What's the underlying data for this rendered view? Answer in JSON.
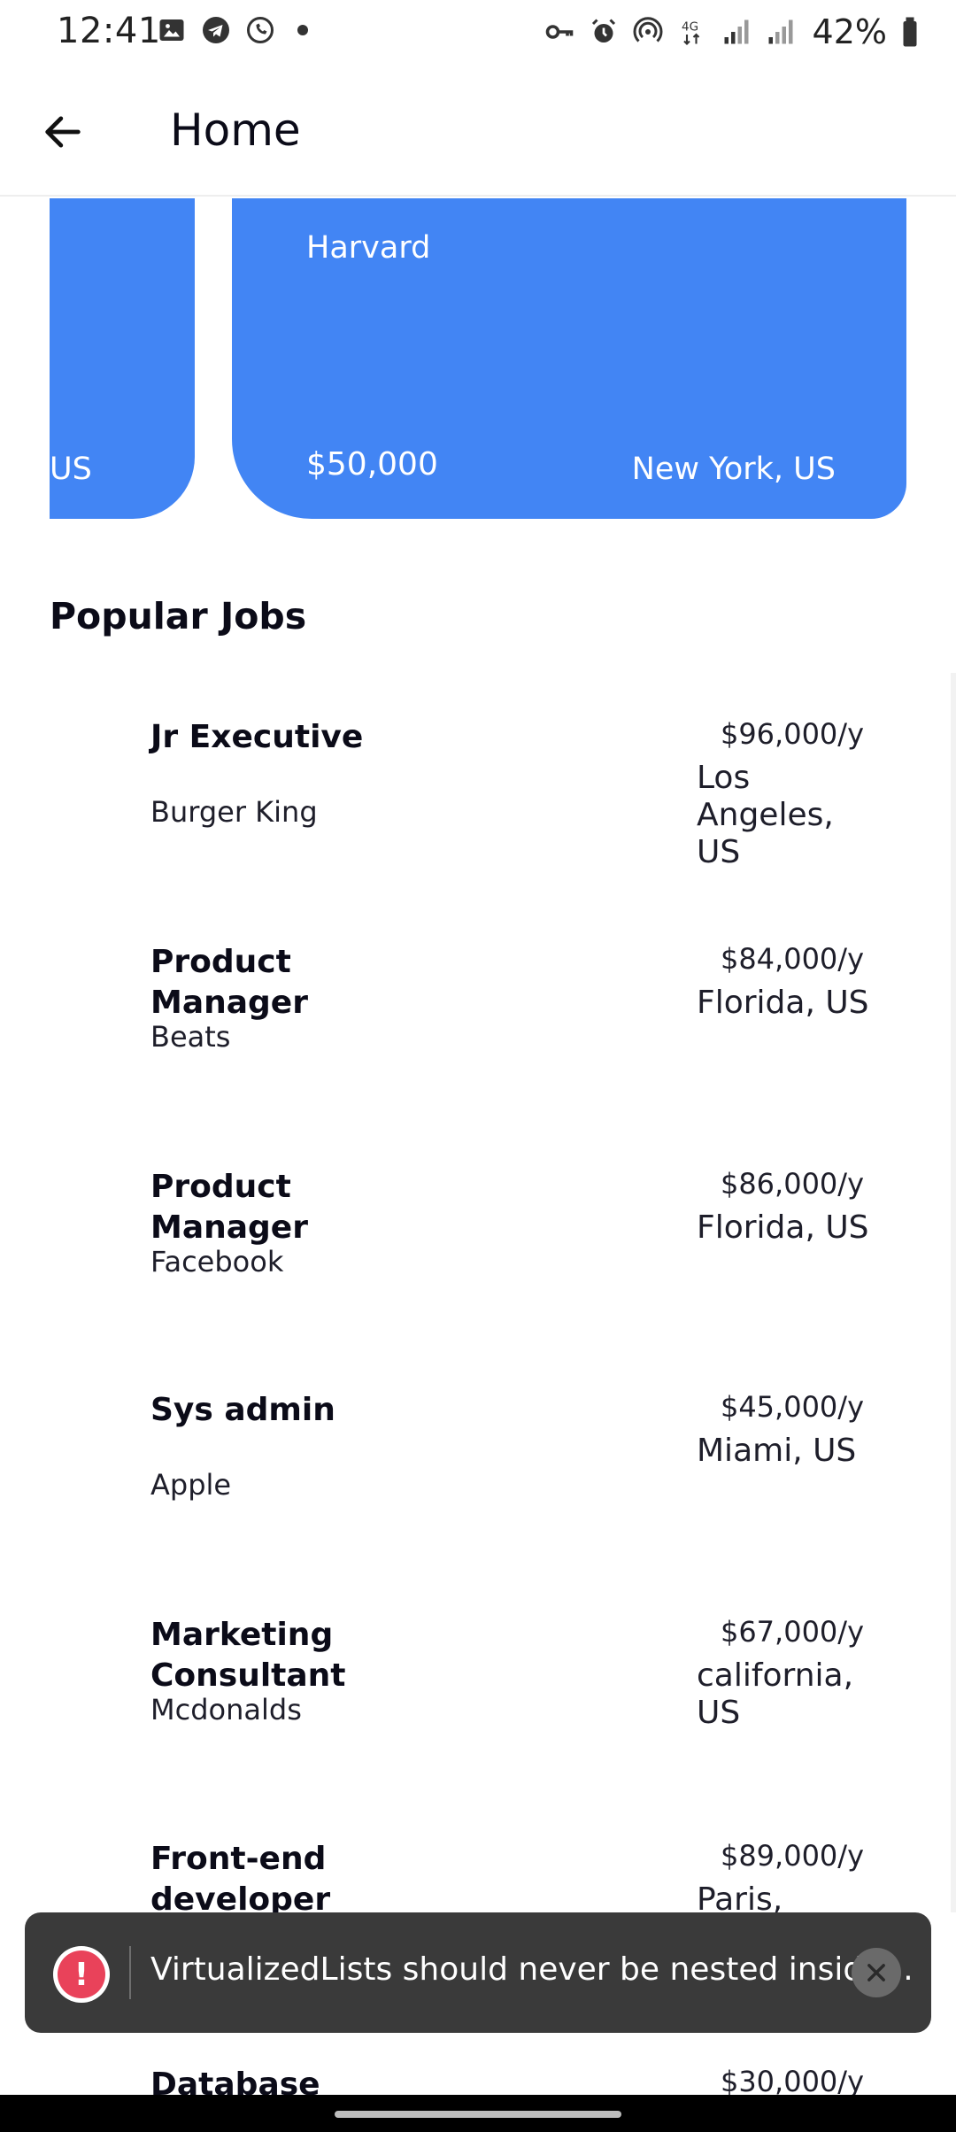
{
  "status_bar": {
    "time": "12:41",
    "left_icons": [
      "image-icon",
      "telegram-icon",
      "whatsapp-icon",
      "dot-icon"
    ],
    "right_icons": [
      "vpn-key-icon",
      "alarm-icon",
      "hotspot-icon",
      "network-4g-icon",
      "signal-icon",
      "signal-icon",
      "battery-icon"
    ],
    "battery": "42%"
  },
  "app_bar": {
    "title": "Home",
    "back_icon": "arrow-left-icon"
  },
  "featured": [
    {
      "company": "",
      "salary": "",
      "location": "US"
    },
    {
      "company": "Harvard",
      "salary": "$50,000",
      "location": "New York, US"
    }
  ],
  "popular": {
    "title": "Popular Jobs",
    "jobs": [
      {
        "title": "Jr Executive",
        "company": "Burger King",
        "salary": "$96,000/y",
        "location": "Los Angeles, US"
      },
      {
        "title": "Product Manager",
        "company": "Beats",
        "salary": "$84,000/y",
        "location": "Florida, US"
      },
      {
        "title": "Product Manager",
        "company": "Facebook",
        "salary": "$86,000/y",
        "location": "Florida, US"
      },
      {
        "title": "Sys admin",
        "company": "Apple",
        "salary": "$45,000/y",
        "location": "Miami, US"
      },
      {
        "title": "Marketing Consultant",
        "company": "Mcdonalds",
        "salary": "$67,000/y",
        "location": "california, US"
      },
      {
        "title": "Front-end developer",
        "company": "",
        "salary": "$89,000/y",
        "location": "Paris, France"
      },
      {
        "title": "Database",
        "company": "",
        "salary": "$30,000/y",
        "location": ""
      }
    ]
  },
  "toast": {
    "message": "VirtualizedLists should never be nested inside...",
    "icon": "error-icon",
    "close_icon": "close-icon",
    "icon_glyph": "!"
  },
  "colors": {
    "card_blue": "#4285f4",
    "toast_bg": "#3a3a3a",
    "error_red": "#e9425a"
  }
}
